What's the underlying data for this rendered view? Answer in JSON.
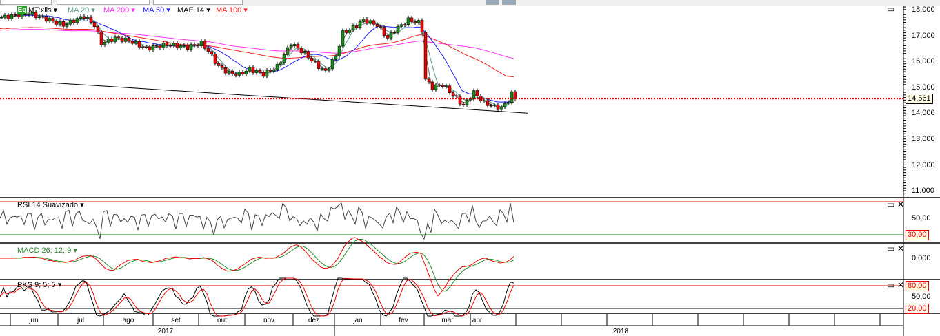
{
  "legend": {
    "symbol": "MT:xlis",
    "icon": "Eq",
    "items": [
      {
        "label": "MA 20",
        "color": "#5aa08a"
      },
      {
        "label": "MA 200",
        "color": "#ff33ff"
      },
      {
        "label": "MA 50",
        "color": "#2020ff"
      },
      {
        "label": "MAE 14",
        "color": "#000000"
      },
      {
        "label": "MA 100",
        "color": "#ee2222"
      }
    ]
  },
  "price_axis": [
    "18,000",
    "17,000",
    "16,000",
    "15,000",
    "14,000",
    "13,000",
    "12,000",
    "11,000"
  ],
  "last_price": "14,561",
  "rsi": {
    "label": "RSI 14 Suavizado",
    "axis": "50,00",
    "low": "30,00"
  },
  "macd": {
    "label": "MACD 26; 12; 9",
    "axis": "0,000"
  },
  "pks": {
    "label": "PKS 9; 5; 5",
    "high": "80,00",
    "mid": "50,00",
    "low": "20,00"
  },
  "months": [
    "jun",
    "jul",
    "ago",
    "set",
    "out",
    "nov",
    "dez",
    "jan",
    "fev",
    "mar",
    "abr"
  ],
  "years": [
    "2017",
    "2018"
  ],
  "chart_data": {
    "type": "candlestick",
    "price_anchors": [
      [
        0,
        17700
      ],
      [
        8,
        17850
      ],
      [
        14,
        17600
      ],
      [
        18,
        17400
      ],
      [
        24,
        17750
      ],
      [
        27,
        17400
      ],
      [
        29,
        16700
      ],
      [
        33,
        16900
      ],
      [
        37,
        16800
      ],
      [
        42,
        16500
      ],
      [
        48,
        16650
      ],
      [
        54,
        16550
      ],
      [
        58,
        16700
      ],
      [
        60,
        16400
      ],
      [
        63,
        15800
      ],
      [
        66,
        15550
      ],
      [
        69,
        15500
      ],
      [
        72,
        15700
      ],
      [
        76,
        15500
      ],
      [
        80,
        15800
      ],
      [
        84,
        16700
      ],
      [
        88,
        16300
      ],
      [
        92,
        15800
      ],
      [
        94,
        15600
      ],
      [
        97,
        16200
      ],
      [
        99,
        17100
      ],
      [
        102,
        17300
      ],
      [
        105,
        17600
      ],
      [
        109,
        17400
      ],
      [
        112,
        16900
      ],
      [
        114,
        17200
      ],
      [
        118,
        17600
      ],
      [
        121,
        17500
      ],
      [
        122,
        17200
      ],
      [
        123,
        15300
      ],
      [
        125,
        15000
      ],
      [
        128,
        15100
      ],
      [
        131,
        14700
      ],
      [
        134,
        14300
      ],
      [
        137,
        14800
      ],
      [
        140,
        14400
      ],
      [
        143,
        14250
      ],
      [
        145,
        14200
      ],
      [
        147,
        14500
      ],
      [
        148,
        14750
      ],
      [
        149,
        14561
      ]
    ],
    "trendline": [
      [
        0,
        15300
      ],
      [
        153,
        14000
      ]
    ],
    "last": 14561,
    "yrange": [
      10700,
      18200
    ]
  }
}
